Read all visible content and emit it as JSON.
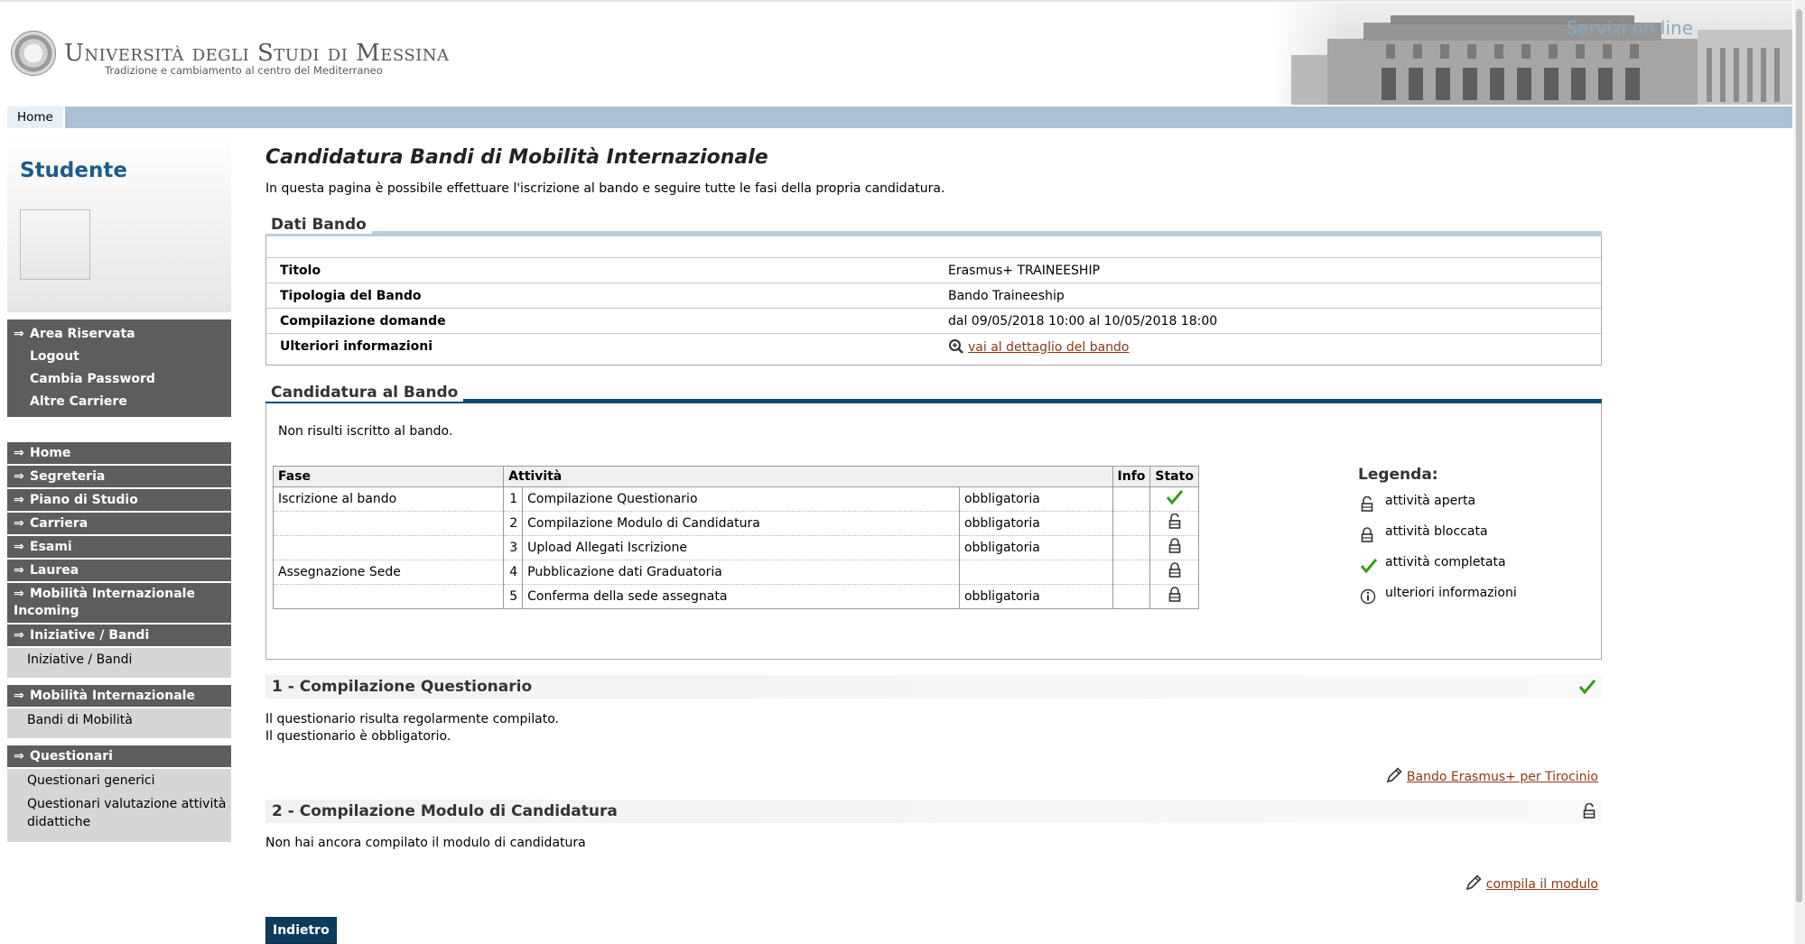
{
  "header": {
    "university": "Università degli Studi di Messina",
    "tagline": "Tradizione e cambiamento al centro del Mediterraneo",
    "servizi": "Servizi on line",
    "nav_home": "Home"
  },
  "sidebar": {
    "title": "Studente",
    "area_riservata": {
      "heading": "Area Riservata",
      "items": [
        "Logout",
        "Cambia Password",
        "Altre Carriere"
      ]
    },
    "menu": [
      {
        "label": "Home"
      },
      {
        "label": "Segreteria"
      },
      {
        "label": "Piano di Studio"
      },
      {
        "label": "Carriera"
      },
      {
        "label": "Esami"
      },
      {
        "label": "Laurea"
      },
      {
        "label": "Mobilità Internazionale Incoming"
      },
      {
        "label": "Iniziative / Bandi",
        "sub": [
          "Iniziative / Bandi"
        ]
      },
      {
        "label": "Mobilità Internazionale",
        "sub": [
          "Bandi di Mobilità"
        ]
      },
      {
        "label": "Questionari",
        "sub": [
          "Questionari generici",
          "Questionari valutazione attività didattiche"
        ]
      }
    ]
  },
  "main": {
    "title": "Candidatura Bandi di Mobilità Internazionale",
    "intro": "In questa pagina è possibile effettuare l'iscrizione al bando e seguire tutte le fasi della propria candidatura.",
    "dati_bando": {
      "heading": "Dati Bando",
      "rows": [
        {
          "label": "Titolo",
          "value": "Erasmus+ TRAINEESHIP"
        },
        {
          "label": "Tipologia del Bando",
          "value": "Bando Traineeship"
        },
        {
          "label": "Compilazione domande",
          "value": "dal 09/05/2018 10:00 al 10/05/2018 18:00"
        },
        {
          "label": "Ulteriori informazioni",
          "value": "vai al dettaglio del bando"
        }
      ]
    },
    "candidatura": {
      "heading": "Candidatura al Bando",
      "status": "Non risulti iscritto al bando.",
      "columns": [
        "Fase",
        "Attività",
        "Info",
        "Stato"
      ],
      "rows": [
        {
          "fase": "Iscrizione al bando",
          "num": "1",
          "attivita": "Compilazione Questionario",
          "tipo": "obbligatoria",
          "stato": "completata"
        },
        {
          "fase": "",
          "num": "2",
          "attivita": "Compilazione Modulo di Candidatura",
          "tipo": "obbligatoria",
          "stato": "aperta"
        },
        {
          "fase": "",
          "num": "3",
          "attivita": "Upload Allegati Iscrizione",
          "tipo": "obbligatoria",
          "stato": "bloccata"
        },
        {
          "fase": "Assegnazione Sede",
          "num": "4",
          "attivita": "Pubblicazione dati Graduatoria",
          "tipo": "",
          "stato": "bloccata"
        },
        {
          "fase": "",
          "num": "5",
          "attivita": "Conferma della sede assegnata",
          "tipo": "obbligatoria",
          "stato": "bloccata"
        }
      ],
      "legenda": {
        "title": "Legenda:",
        "items": [
          "attività aperta",
          "attività bloccata",
          "attività completata",
          "ulteriori informazioni"
        ]
      }
    },
    "sections": [
      {
        "title": "1 - Compilazione Questionario",
        "lines": [
          "Il questionario risulta regolarmente compilato.",
          "Il questionario è obbligatorio."
        ],
        "action": "Bando Erasmus+ per Tirocinio"
      },
      {
        "title": "2 - Compilazione Modulo di Candidatura",
        "lines": [
          "Non hai ancora compilato il modulo di candidatura"
        ],
        "action": "compila il modulo"
      }
    ],
    "back_button": "Indietro"
  },
  "colors": {
    "accent_blue": "#1a5c8c",
    "nav_bar": "#a9c2d4",
    "sidebar_dark": "#5d5d5d",
    "link": "#8a3a14",
    "check_green": "#3b9a1e",
    "button": "#0d3b5e"
  }
}
